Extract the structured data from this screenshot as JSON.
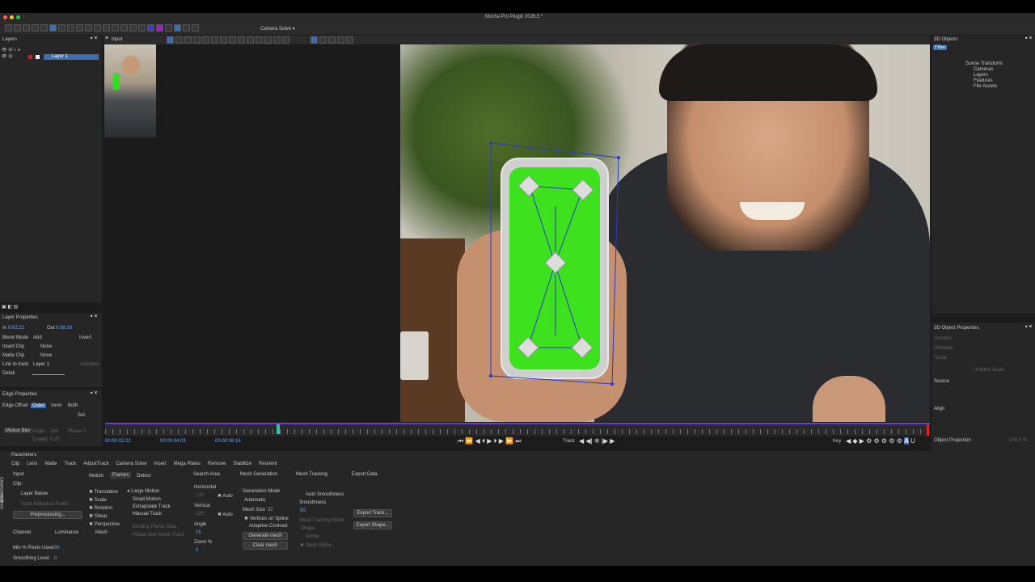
{
  "window": {
    "title": "Mocha Pro Plugin 2026.5 *"
  },
  "toolbar": {
    "camera_solve": "Camera Solve ▾"
  },
  "layers": {
    "title": "Layers",
    "layer1": "Layer 1"
  },
  "viewer": {
    "title": "Input"
  },
  "layer_props": {
    "title": "Layer Properties",
    "in_label": "In",
    "in_value": "0:02:22",
    "out_label": "Out",
    "out_value": "0:08:16",
    "blend_mode": "Blend Mode",
    "blend_value": "Add",
    "invert": "Invert",
    "insert_clip": "Insert Clip",
    "insert_value": "None",
    "matte_clip": "Matte Clip",
    "matte_value": "None",
    "link_to_track": "Link to track",
    "link_value": "Layer 1",
    "adjusted": "Adjusted",
    "detail": "Detail"
  },
  "edge_props": {
    "title": "Edge Properties",
    "edge_offset": "Edge Offset",
    "outer": "Outer",
    "inner": "Inner",
    "both": "Both",
    "set": "Set",
    "motion_blur": "Motion Blur",
    "angle": "Angle",
    "phase": "Phase",
    "quality": "Quality",
    "angle_v": "180",
    "phase_v": "0",
    "quality_v": "0.25"
  },
  "objects3d": {
    "title": "3D Objects",
    "filter": "Filter",
    "scene_transform": "Scene Transform",
    "cameras": "Cameras",
    "layers": "Layers",
    "features": "Features",
    "file_assets": "File Assets"
  },
  "obj_props": {
    "title": "3D Object Properties",
    "position": "Position",
    "rotation": "Rotation",
    "scale": "Scale",
    "uniform_scale": "Uniform Scale",
    "source": "Source",
    "align": "Align",
    "object_projection": "Object Projection",
    "proj_value": "100.0 %"
  },
  "timeline": {
    "current": "00:00:02:22",
    "mid": "00:00:04:03",
    "end": "00:00:08:16",
    "track": "Track",
    "key": "Key"
  },
  "params": {
    "title": "Parameters",
    "tabs": [
      "Clip",
      "Lens",
      "Matte",
      "Track",
      "AdjustTrack",
      "Camera Solve",
      "Insert",
      "Mega Plates",
      "Remove",
      "Stabilize",
      "Reorient"
    ],
    "side_tabs": [
      "Parameters",
      "Graphs"
    ],
    "input": "Input",
    "clip": "Clip:",
    "layer_below": "Layer Below",
    "track_individual": "Track Individual Fields",
    "preprocessing": "Preprocessing...",
    "channel": "Channel",
    "luminance": "Luminance",
    "min_pixels": "Min % Pixels Used",
    "min_pixels_v": "90",
    "smoothing": "Smoothing Level",
    "smoothing_v": "0",
    "motion": "Motion",
    "frames": "Frames",
    "detect": "Detect",
    "translation": "Translation",
    "scale": "Scale",
    "rotation": "Rotation",
    "shear": "Shear",
    "perspective": "Perspective",
    "mesh": "Mesh",
    "large_motion": "Large Motion",
    "small_motion": "Small Motion",
    "extrapolate": "Extrapolate Track",
    "manual": "Manual Track",
    "existing_planar": "Existing Planar Data",
    "planar_mesh": "Planar from Mesh Track",
    "search_area": "Search Area",
    "horizontal": "Horizontal",
    "vertical": "Vertical",
    "auto": "Auto",
    "angle": "Angle",
    "angle_v": "15",
    "zoom": "Zoom %",
    "zoom_v": "0",
    "h_v": "120",
    "v_v": "120",
    "mesh_generation": "Mesh Generation",
    "gen_mode": "Generation Mode",
    "automatic": "Automatic",
    "mesh_size": "Mesh Size",
    "mesh_size_v": "32",
    "vertices_spline": "Vertices on Spline",
    "adaptive": "Adaptive Contrast",
    "generate": "Generate mesh",
    "clear": "Clear mesh",
    "mesh_tracking": "Mesh Tracking",
    "auto_smooth": "Auto Smoothness",
    "smoothness": "Smoothness",
    "smooth_v": "50",
    "mesh_tracking_mode": "Mesh Tracking Mode",
    "shape": "Shape",
    "active": "Active",
    "warp_spline": "Warp Spline",
    "export_data": "Export Data",
    "export_track": "Export Track...",
    "export_shape": "Export Shape..."
  }
}
